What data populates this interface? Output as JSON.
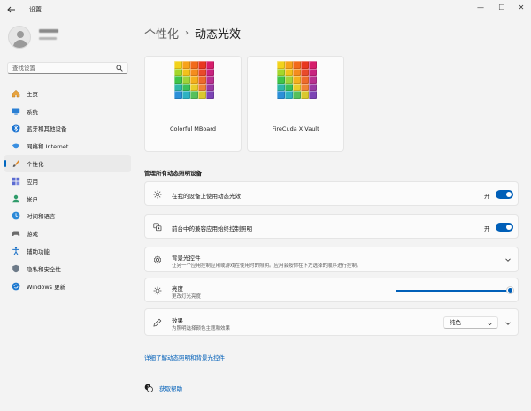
{
  "window": {
    "app_title": "设置",
    "minimize_glyph": "—",
    "maximize_glyph": "☐",
    "close_glyph": "✕"
  },
  "search": {
    "placeholder": "查找设置"
  },
  "sidebar": {
    "items": [
      {
        "label": "主页",
        "icon": "home-icon"
      },
      {
        "label": "系统",
        "icon": "system-icon"
      },
      {
        "label": "蓝牙和其他设备",
        "icon": "bluetooth-icon"
      },
      {
        "label": "网络和 Internet",
        "icon": "network-icon"
      },
      {
        "label": "个性化",
        "icon": "brush-icon",
        "active": true
      },
      {
        "label": "应用",
        "icon": "apps-icon"
      },
      {
        "label": "帐户",
        "icon": "account-icon"
      },
      {
        "label": "时间和语言",
        "icon": "time-language-icon"
      },
      {
        "label": "游戏",
        "icon": "gaming-icon"
      },
      {
        "label": "辅助功能",
        "icon": "accessibility-icon"
      },
      {
        "label": "隐私和安全性",
        "icon": "shield-icon"
      },
      {
        "label": "Windows 更新",
        "icon": "windows-update-icon"
      }
    ]
  },
  "header": {
    "parent": "个性化",
    "current": "动态光效"
  },
  "devices": [
    {
      "name": "Colorful MBoard"
    },
    {
      "name": "FireCuda X Vault"
    }
  ],
  "section_title": "管理所有动态照明设备",
  "settings": {
    "use_dynamic_lighting": {
      "title": "在我的设备上使用动态光效",
      "toggle_label": "开",
      "on": true
    },
    "compatible_apps": {
      "title": "前台中的兼容应用始终控制照明",
      "toggle_label": "开",
      "on": true
    },
    "background_control": {
      "title": "背景光控件",
      "description": "让另一个应用控制应用或游戏在使用时的照明。应用会按你在下方选择的顺序进行控制。"
    },
    "brightness": {
      "title": "亮度",
      "description": "更改灯光亮度",
      "value_fraction": 1.0
    },
    "effects": {
      "title": "效果",
      "description": "为照明选择颜色主题和效果",
      "selected": "纯色"
    }
  },
  "links": {
    "learn_more": "详细了解动态照明和背景光控件",
    "get_help": "获取帮助"
  },
  "colors": {
    "accent": "#005fb8",
    "background": "#f3f3f3",
    "card": "#fbfbfb"
  }
}
